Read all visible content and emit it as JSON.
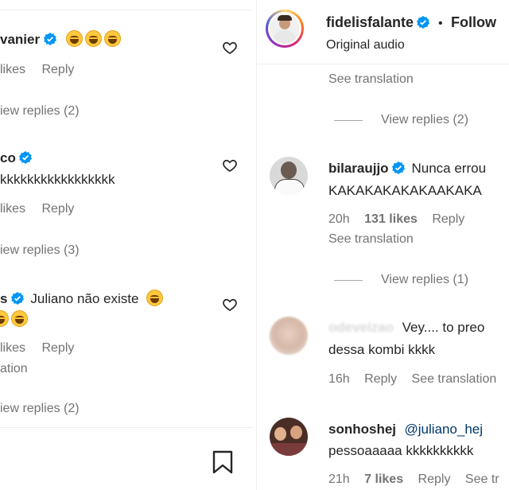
{
  "left": {
    "comments": [
      {
        "user": "vanier",
        "text": "",
        "emojis": 3,
        "meta_likes": "likes",
        "meta_reply": "Reply",
        "view_replies": "iew replies (2)"
      },
      {
        "user": "co",
        "text": "kkkkkkkkkkkkkkkkk",
        "meta_likes": "likes",
        "meta_reply": "Reply",
        "view_replies": "iew replies (3)"
      },
      {
        "user": "s",
        "text": "Juliano não existe",
        "text2_emojis": 2,
        "meta_likes": "likes",
        "meta_reply": "Reply",
        "translation": "ation",
        "view_replies": "iew replies (2)"
      }
    ]
  },
  "header": {
    "username": "fidelisfalante",
    "separator": "•",
    "follow": "Follow",
    "subtitle": "Original audio"
  },
  "right": {
    "see_translation_top": "See translation",
    "view_replies_1": "View replies (2)",
    "comment1": {
      "user": "bilaraujjo",
      "text": "Nunca errou",
      "text2": "KAKAKAKAKAKAAKAKA",
      "time": "20h",
      "likes": "131 likes",
      "reply": "Reply",
      "see_translation": "See translation"
    },
    "view_replies_2": "View replies (1)",
    "comment2": {
      "user": "odeveizao",
      "text": "Vey.... to preo",
      "text2": "dessa kombi kkkk",
      "time": "16h",
      "reply": "Reply",
      "see_translation": "See translation"
    },
    "comment3": {
      "user": "sonhoshej",
      "mention": "@juliano_hej",
      "text2": "pessoaaaaa kkkkkkkkkk",
      "time": "21h",
      "likes": "7 likes",
      "reply": "Reply",
      "see_translation": "See tr"
    }
  },
  "colors": {
    "verified": "#0095f6",
    "text": "#262626",
    "muted": "#737373",
    "link": "#00376b"
  }
}
